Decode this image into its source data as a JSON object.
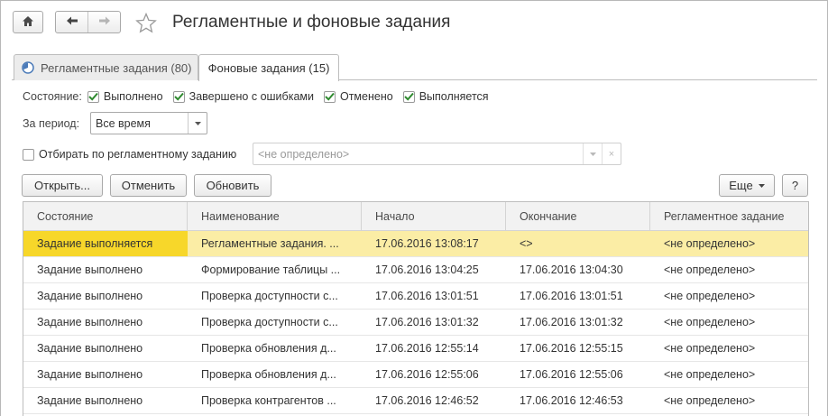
{
  "header": {
    "title": "Регламентные и фоновые задания"
  },
  "tabs": [
    {
      "label": "Регламентные задания (80)",
      "active": false
    },
    {
      "label": "Фоновые задания (15)",
      "active": true
    }
  ],
  "filters": {
    "state_label": "Состояние:",
    "states": [
      {
        "label": "Выполнено",
        "checked": true
      },
      {
        "label": "Завершено с ошибками",
        "checked": true
      },
      {
        "label": "Отменено",
        "checked": true
      },
      {
        "label": "Выполняется",
        "checked": true
      }
    ],
    "period_label": "За период:",
    "period_value": "Все время",
    "sched_filter_label": "Отбирать по регламентному заданию",
    "sched_filter_checked": false,
    "sched_filter_value": "<не определено>"
  },
  "toolbar": {
    "open": "Открыть...",
    "cancel": "Отменить",
    "refresh": "Обновить",
    "more": "Еще",
    "help": "?"
  },
  "table": {
    "columns": [
      "Состояние",
      "Наименование",
      "Начало",
      "Окончание",
      "Регламентное задание"
    ],
    "rows": [
      [
        "Задание выполняется",
        "Регламентные задания. ...",
        "17.06.2016 13:08:17",
        "<>",
        "<не определено>"
      ],
      [
        "Задание выполнено",
        "Формирование таблицы ...",
        "17.06.2016 13:04:25",
        "17.06.2016 13:04:30",
        "<не определено>"
      ],
      [
        "Задание выполнено",
        "Проверка доступности с...",
        "17.06.2016 13:01:51",
        "17.06.2016 13:01:51",
        "<не определено>"
      ],
      [
        "Задание выполнено",
        "Проверка доступности с...",
        "17.06.2016 13:01:32",
        "17.06.2016 13:01:32",
        "<не определено>"
      ],
      [
        "Задание выполнено",
        "Проверка обновления д...",
        "17.06.2016 12:55:14",
        "17.06.2016 12:55:15",
        "<не определено>"
      ],
      [
        "Задание выполнено",
        "Проверка обновления д...",
        "17.06.2016 12:55:06",
        "17.06.2016 12:55:06",
        "<не определено>"
      ],
      [
        "Задание выполнено",
        "Проверка контрагентов ...",
        "17.06.2016 12:46:52",
        "17.06.2016 12:46:53",
        "<не определено>"
      ]
    ],
    "selected_row": 0
  },
  "colors": {
    "selected_row": "#fbeda5",
    "selected_cell": "#f7d72a",
    "checkmark": "#2f8a2f"
  }
}
